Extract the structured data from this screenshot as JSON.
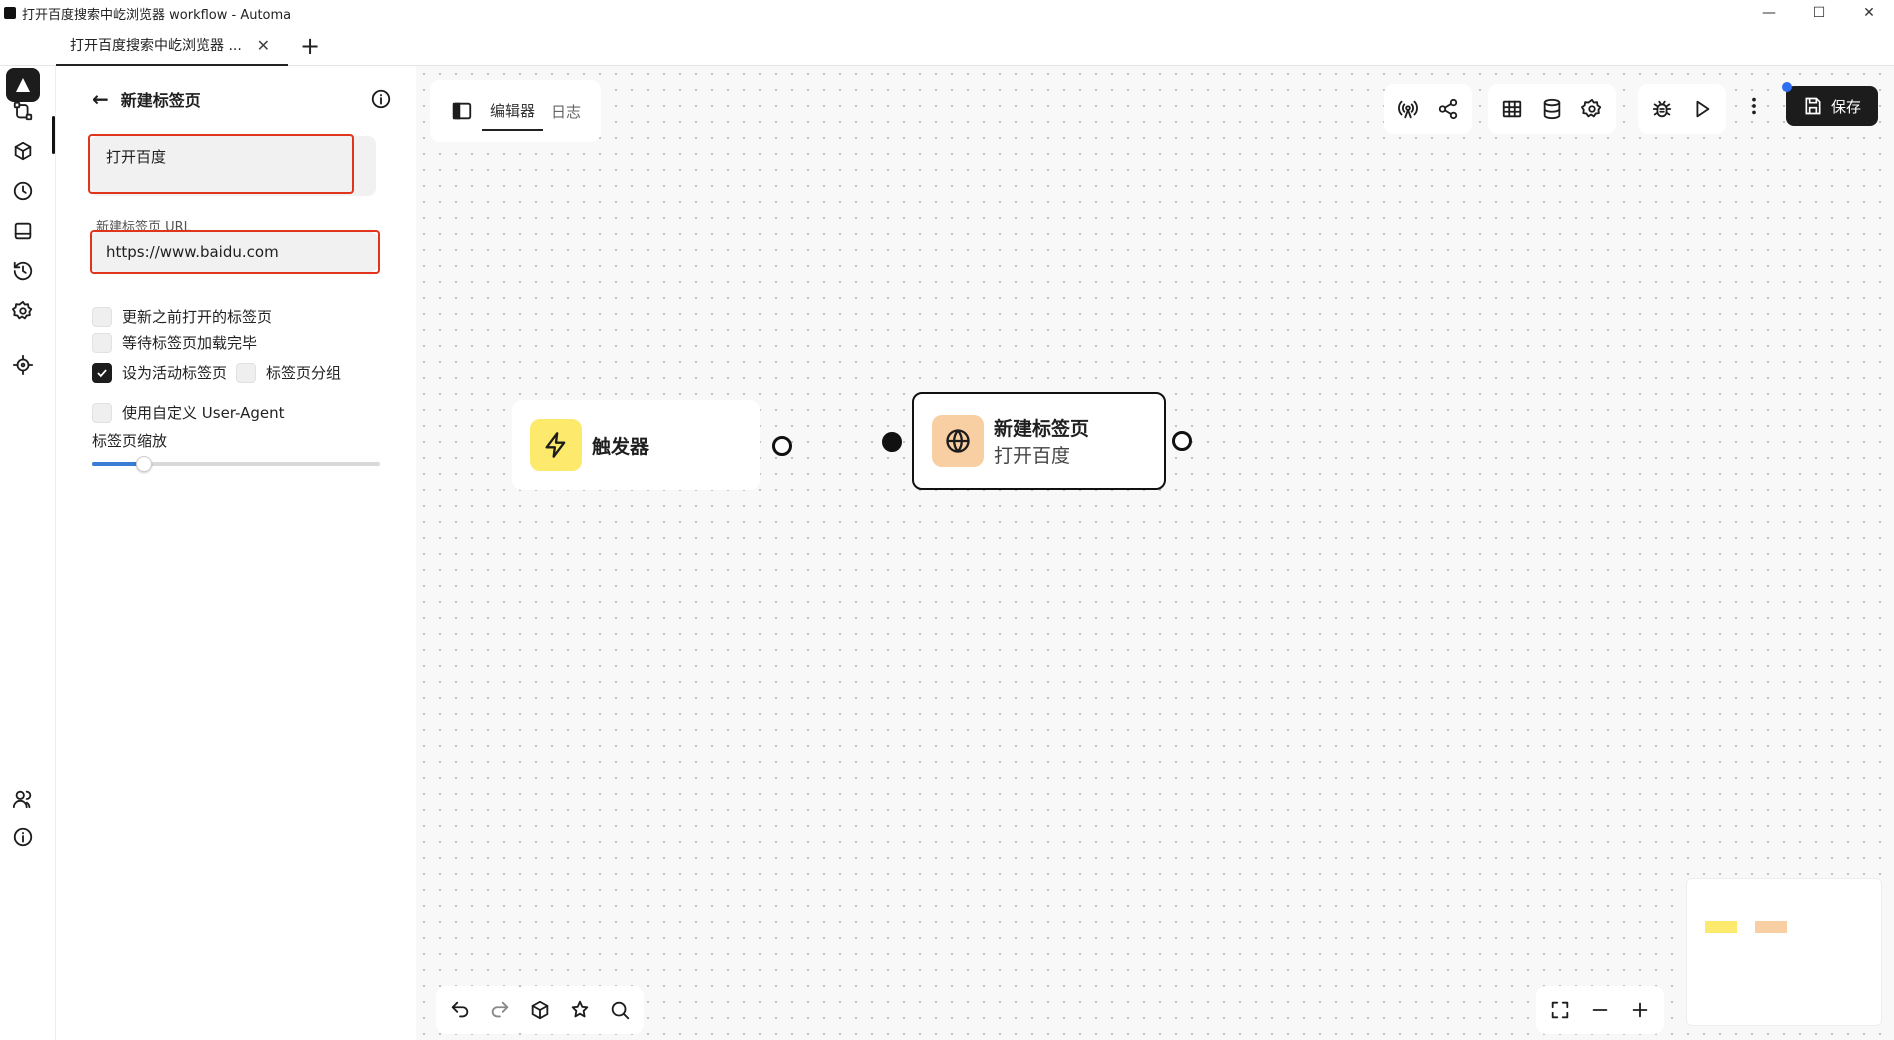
{
  "window": {
    "title": "打开百度搜索中屹浏览器 workflow - Automa",
    "controls": {
      "minimize": "—",
      "maximize": "☐",
      "close": "✕"
    }
  },
  "tabs": [
    {
      "label": "打开百度搜索中屹浏览器 ...",
      "close": "✕"
    }
  ],
  "new_tab_label": "+",
  "panel": {
    "title": "新建标签页",
    "description_value": "打开百度",
    "url_label": "新建标签页 URL",
    "url_value": "https://www.baidu.com",
    "options": [
      {
        "label": "更新之前打开的标签页",
        "checked": false
      },
      {
        "label": "等待标签页加载完毕",
        "checked": false
      },
      {
        "label": "设为活动标签页",
        "checked": true
      },
      {
        "label": "标签页分组",
        "checked": false
      },
      {
        "label": "使用自定义 User-Agent",
        "checked": false
      }
    ],
    "zoom_label": "标签页缩放",
    "zoom_value": 0.18
  },
  "editor": {
    "tabs": [
      {
        "label": "编辑器",
        "active": true
      },
      {
        "label": "日志",
        "active": false
      }
    ],
    "save_label": "保存"
  },
  "nodes": {
    "trigger": {
      "title": "触发器",
      "icon": "lightning-icon",
      "icon_bg": "#fde96b"
    },
    "new_tab": {
      "title": "新建标签页",
      "subtitle": "打开百度",
      "icon": "globe-icon",
      "icon_bg": "#f8cfa2"
    }
  },
  "colors": {
    "accent": "#1c1c1c",
    "highlight": "#e0341c",
    "slider": "#3a7bd5",
    "save_dot": "#2f6ef0"
  }
}
